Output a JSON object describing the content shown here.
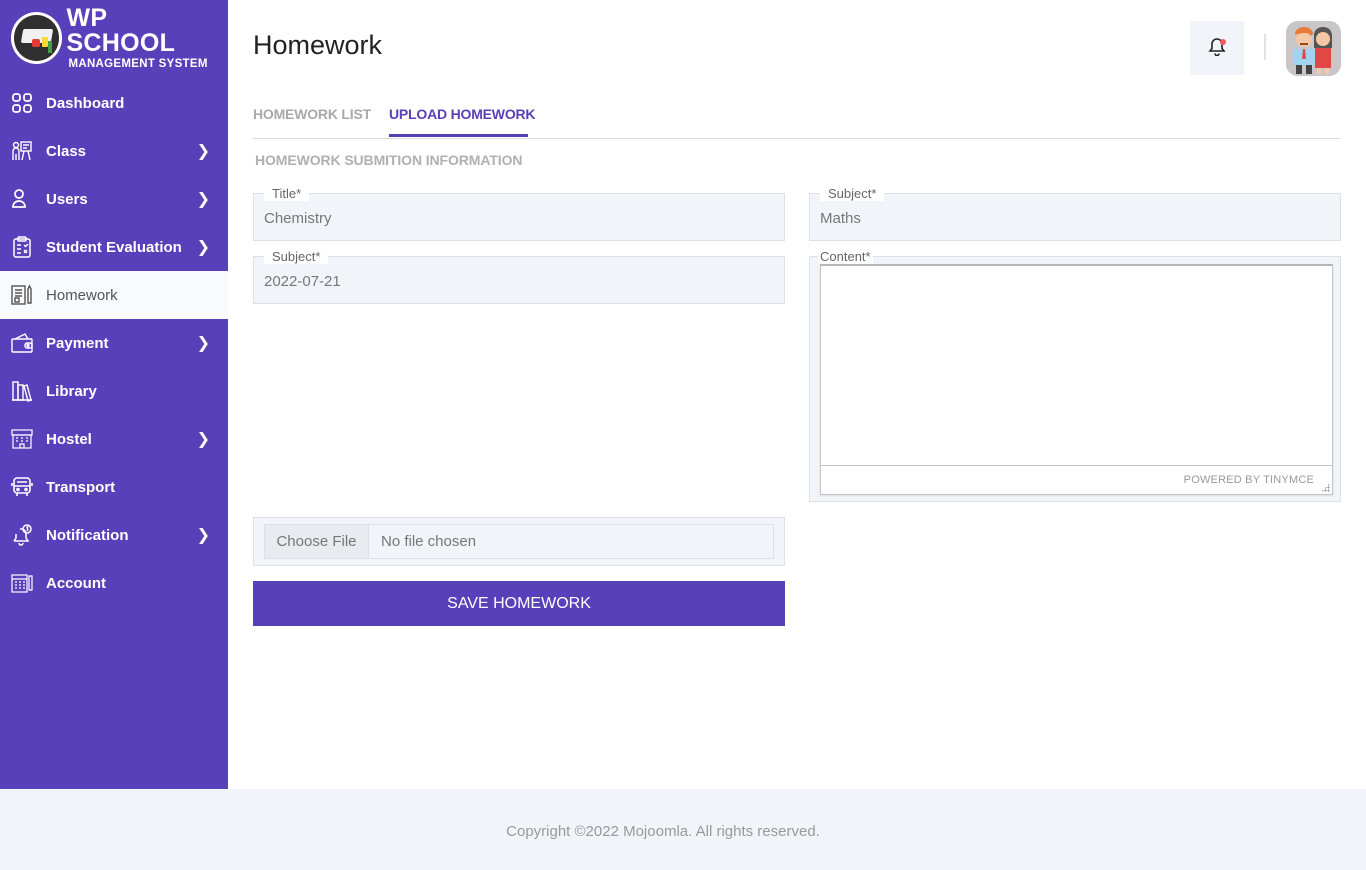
{
  "brand": {
    "title": "WP SCHOOL",
    "subtitle": "MANAGEMENT SYSTEM"
  },
  "sidebar": {
    "items": [
      {
        "label": "Dashboard",
        "icon": "dashboard-grid-icon",
        "has_submenu": false,
        "active": false
      },
      {
        "label": "Class",
        "icon": "classroom-teacher-icon",
        "has_submenu": true,
        "active": false
      },
      {
        "label": "Users",
        "icon": "user-icon",
        "has_submenu": true,
        "active": false
      },
      {
        "label": "Student Evaluation",
        "icon": "clipboard-checklist-icon",
        "has_submenu": true,
        "active": false
      },
      {
        "label": "Homework",
        "icon": "homework-notebook-icon",
        "has_submenu": false,
        "active": true
      },
      {
        "label": "Payment",
        "icon": "wallet-icon",
        "has_submenu": true,
        "active": false
      },
      {
        "label": "Library",
        "icon": "books-icon",
        "has_submenu": false,
        "active": false
      },
      {
        "label": "Hostel",
        "icon": "hostel-building-icon",
        "has_submenu": true,
        "active": false
      },
      {
        "label": "Transport",
        "icon": "bus-icon",
        "has_submenu": false,
        "active": false
      },
      {
        "label": "Notification",
        "icon": "bell-notification-icon",
        "has_submenu": true,
        "active": false
      },
      {
        "label": "Account",
        "icon": "account-ledger-icon",
        "has_submenu": false,
        "active": false
      }
    ]
  },
  "header": {
    "title": "Homework",
    "notification_icon": "bell-icon",
    "has_unread": true,
    "avatar": "parents-avatar"
  },
  "tabs": [
    {
      "label": "HOMEWORK LIST",
      "active": false
    },
    {
      "label": "UPLOAD HOMEWORK",
      "active": true
    }
  ],
  "form": {
    "section_title": "HOMEWORK SUBMITION INFORMATION",
    "title_field": {
      "label": "Title*",
      "value": "Chemistry"
    },
    "subject_field": {
      "label": "Subject*",
      "value": "Maths"
    },
    "date_field": {
      "label": "Subject*",
      "value": "2022-07-21"
    },
    "content_field": {
      "label": "Content*",
      "value": "",
      "powered_by": "POWERED BY TINYMCE"
    },
    "file": {
      "button_label": "Choose File",
      "status": "No file chosen"
    },
    "save_label": "SAVE HOMEWORK"
  },
  "footer": {
    "text": "Copyright ©2022 Mojoomla. All rights reserved."
  },
  "colors": {
    "brand": "#5840ba",
    "field_bg": "#f1f4f9",
    "notification_dot": "#f25c5c"
  }
}
